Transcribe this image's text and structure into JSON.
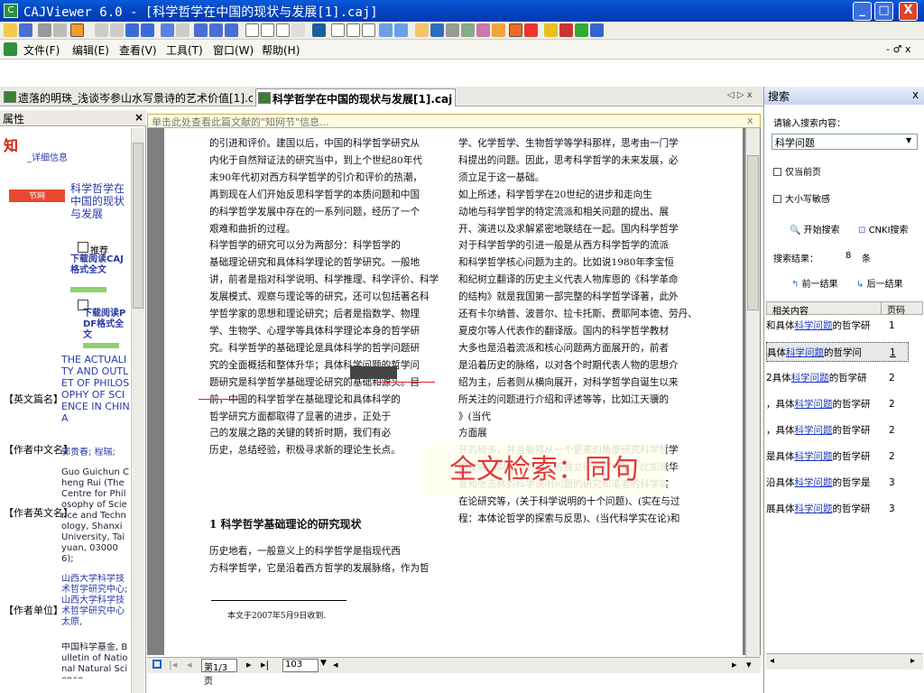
{
  "window": {
    "title": "CAJViewer 6.0 - [科学哲学在中国的现状与发展[1].caj]",
    "minimize": "_",
    "maximize": "□",
    "close": "X"
  },
  "menu": {
    "items": [
      "文件(F)",
      "编辑(E)",
      "查看(V)",
      "工具(T)",
      "窗口(W)",
      "帮助(H)"
    ],
    "mdi_controls": "- ♂ x"
  },
  "tabs": [
    {
      "label": "遗落的明珠_浅谈岑参山水写景诗的艺术价值[1].caj",
      "active": false
    },
    {
      "label": "科学哲学在中国的现状与发展[1].caj",
      "active": true
    }
  ],
  "tab_nav": "◁ ▷ x",
  "left_panel": {
    "title": "属性",
    "close": "×",
    "logo_text": "_详细信息",
    "title_link": "科学哲学在中国的现状与发展",
    "recommend": "推荐",
    "caj_link": "下载阅读CAJ格式全文",
    "pdf_link": "下载阅读PDF格式全文",
    "fields": [
      {
        "label": "【英文篇名】",
        "value": "THE ACTUALITY AND OUTLET OF PHILOSOPHY OF SCIENCE IN CHINA"
      },
      {
        "label": "【作者中文名】",
        "value": "郭贵春; 程瑞;"
      },
      {
        "label": "【作者英文名】",
        "value": "Guo Guichun Cheng Rui (The Centre for Philosophy of Science and Technology, Shanxi University, Taiyuan, 030006);"
      },
      {
        "label": "【作者单位】",
        "value": "山西大学科学技术哲学研究中心;山西大学科学技术哲学研究中心 太原,"
      },
      {
        "label": "",
        "value": "中国科学基金, Bulletin of National Natural Science"
      }
    ]
  },
  "document": {
    "info_bar": "单击此处查看此篇文献的\"知网节\"信息...",
    "left_col": [
      "的引进和评价。建国以后，中国的科学哲学研究从",
      "内化于自然辩证法的研究当中，到上个世纪80年代",
      "末90年代初对西方科学哲学的引介和评价的热潮，",
      "再到现在人们开始反思科学哲学的本质问题和中国",
      "的科学哲学发展中存在的一系列问题，经历了一个",
      "艰难和曲折的过程。",
      "    科学哲学的研究可以分为两部分：科学哲学的",
      "基础理论研究和具体科学理论的哲学研究。一般地",
      "讲，前者是指对科学说明、科学推理、科学评价、科学",
      "发展模式、观察与理论等的研究，还可以包括著名科",
      "学哲学家的思想和理论研究；后者是指数学、物理",
      "学、生物学、心理学等具体科学理论本身的哲学研",
      "究。科学哲学的基础理论是具体科学的哲学问题研",
      "究的全面概括和整体升华；具体科学问题的哲学问",
      "题研究是科学哲学基础理论研究的基础和源头。目",
      "前，中国的科学哲学在基础理论和具体科学的",
      "哲学研究方面都取得了显著的进步，正处于",
      "己的发展之路的关键的转折时期，我们有必",
      "历史，总结经验，积极寻求新的理论生长点。"
    ],
    "section_heading": "1  科学哲学基础理论的研究现状",
    "left_col2": [
      "    历史地看，一般意义上的科学哲学是指现代西",
      "方科学哲学，它是沿着西方哲学的发展脉络，作为哲"
    ],
    "footnote": "本文于2007年5月9日收到.",
    "right_col": [
      "学、化学哲学、生物哲学等学科那样，思考由一门学",
      "科提出的问题。因此，思考科学哲学的未来发展，必",
      "须立足于这一基础。",
      "    如上所述，科学哲学在20世纪的进步和走向生",
      "动地与科学哲学的特定流派和相关问题的提出、展",
      "开、演进以及求解紧密地联结在一起。国内科学哲学",
      "对于科学哲学的引进一般是从西方科学哲学的流派",
      "和科学哲学核心问题为主的。比如说1980年李宝恒",
      "和纪树立翻译的历史主义代表人物库恩的《科学革命",
      "的结构》就是我国第一部完整的科学哲学译著，此外",
      "还有卡尔纳普、波普尔、拉卡托斯、费耶阿本德、劳丹、",
      "夏皮尔等人代表作的翻译版。国内的科学哲学教材",
      "大多也是沿着流派和核心问题两方面展开的，前者",
      "是沿着历史的脉络，以对各个时期代表人物的思想介",
      "绍为主，后者则从横向展开，对科学哲学自诞生以来",
      "所关注的问题进行介绍和评述等等，比如江天骥的",
      "                                              》(当代",
      "                                              方面展",
      "开的较多，并且能够从一个更高的角度研究科学哲学",
      "的发展，同时融汇自己的独立研究的成果。比如张华",
      "夏和张志林的科学说明问题的研究和笔者的科学实",
      "在论研究等，(关于科学说明的十个问题)、(实在与过",
      "程：本体论哲学的探索与反思)、(当代科学实在论)和"
    ],
    "overlay": "全文检索：同句",
    "page_indicator": "第1/3页",
    "zoom": "103"
  },
  "search_panel": {
    "title": "搜索",
    "close": "x",
    "prompt": "请输入搜索内容：",
    "query": "科学问题",
    "opt_current_page": "仅当前页",
    "opt_case": "大小写敏感",
    "start_search": "开始搜索",
    "cnki_search": "CNKI搜索",
    "result_label": "搜索结果：",
    "result_count": "8",
    "result_unit": "条",
    "prev": "前一结果",
    "next": "后一结果",
    "col_content": "相关内容",
    "col_page": "页码",
    "results": [
      {
        "pre": "和具体",
        "hit": "科学问题",
        "post": "的哲学研",
        "page": "1"
      },
      {
        "pre": "具体",
        "hit": "科学问题",
        "post": "的哲学问",
        "page": "1"
      },
      {
        "pre": "2具体",
        "hit": "科学问题",
        "post": "的哲学研",
        "page": "2"
      },
      {
        "pre": "，具体",
        "hit": "科学问题",
        "post": "的哲学研",
        "page": "2"
      },
      {
        "pre": "，具体",
        "hit": "科学问题",
        "post": "的哲学研",
        "page": "2"
      },
      {
        "pre": "是具体",
        "hit": "科学问题",
        "post": "的哲学研",
        "page": "2"
      },
      {
        "pre": "沿具体",
        "hit": "科学问题",
        "post": "的哲学是",
        "page": "3"
      },
      {
        "pre": "展具体",
        "hit": "科学问题",
        "post": "的哲学研",
        "page": "3"
      }
    ]
  }
}
